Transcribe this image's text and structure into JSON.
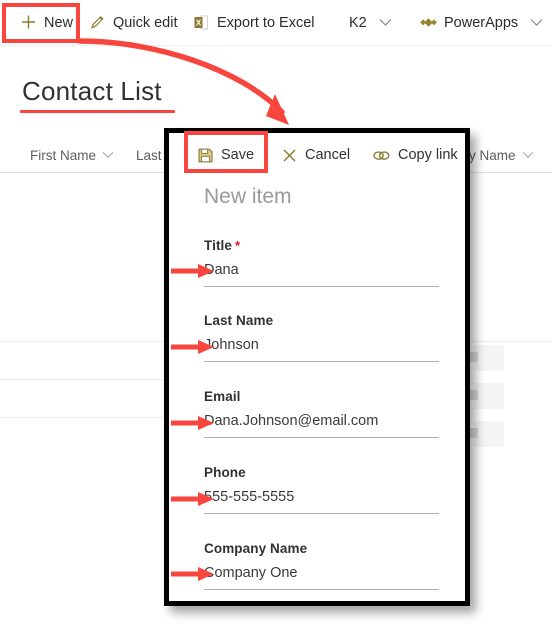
{
  "commandbar": {
    "items": [
      {
        "label": "New",
        "icon": "plus-icon",
        "chevron": ""
      },
      {
        "label": "Quick edit",
        "icon": "pencil-icon",
        "chevron": ""
      },
      {
        "label": "Export to Excel",
        "icon": "excel-icon",
        "chevron": ""
      },
      {
        "label": "K2",
        "icon": "",
        "chevron": "⌄"
      },
      {
        "label": "PowerApps",
        "icon": "powerapps-icon",
        "chevron": "⌄"
      }
    ]
  },
  "page": {
    "title": "Contact List"
  },
  "list": {
    "columns": [
      {
        "label": "First Name",
        "chevron": "⌄"
      },
      {
        "label": "Last",
        "chevron": ""
      },
      {
        "label": "y Name",
        "chevron": "⌄"
      }
    ]
  },
  "panel": {
    "commands": [
      {
        "label": "Save",
        "icon": "floppy-disk-icon"
      },
      {
        "label": "Cancel",
        "icon": "close-icon"
      },
      {
        "label": "Copy link",
        "icon": "link-icon"
      }
    ],
    "heading": "New item",
    "fields": [
      {
        "label": "Title",
        "required": "*",
        "value": "Dana"
      },
      {
        "label": "Last Name",
        "required": "",
        "value": "Johnson"
      },
      {
        "label": "Email",
        "required": "",
        "value": "Dana.Johnson@email.com"
      },
      {
        "label": "Phone",
        "required": "",
        "value": "555-555-5555"
      },
      {
        "label": "Company Name",
        "required": "",
        "value": "Company One"
      }
    ]
  },
  "annotations": {
    "accent_color": "#f8463f",
    "highlighted": [
      "New",
      "Save"
    ]
  }
}
